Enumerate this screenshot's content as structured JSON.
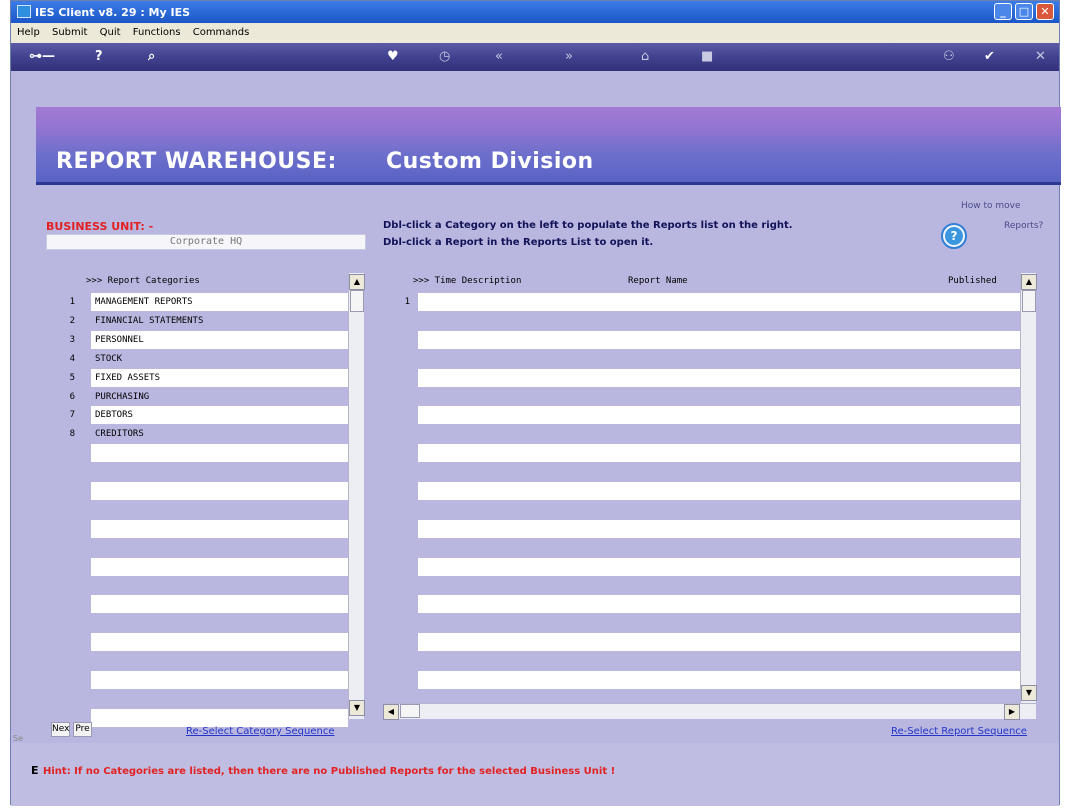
{
  "window": {
    "title": "IES Client v8. 29 : My IES"
  },
  "menu": [
    "Help",
    "Submit",
    "Quit",
    "Functions",
    "Commands"
  ],
  "toolbar": {
    "icons": [
      "key-icon",
      "help-icon",
      "search-icon",
      "heart-icon",
      "clock-icon",
      "rewind-icon",
      "forward-icon",
      "fold-icon",
      "stop-icon",
      "link-icon",
      "check-icon",
      "close-icon"
    ]
  },
  "banner": {
    "title": "REPORT WAREHOUSE:",
    "subtitle": "Custom Division"
  },
  "business_unit": {
    "label": "BUSINESS UNIT: -",
    "value": "Corporate HQ"
  },
  "instructions": [
    "Dbl-click a Category on the left to populate the Reports list on the right.",
    "Dbl-click a Report in the Reports  List  to open it."
  ],
  "how_to": {
    "line1": "How to move",
    "line2": "Reports?",
    "icon": "question-icon"
  },
  "categories": {
    "header": ">>> Report Categories",
    "rows": [
      {
        "n": "1",
        "name": "MANAGEMENT REPORTS"
      },
      {
        "n": "2",
        "name": "FINANCIAL STATEMENTS"
      },
      {
        "n": "3",
        "name": "PERSONNEL"
      },
      {
        "n": "4",
        "name": "STOCK"
      },
      {
        "n": "5",
        "name": "FIXED ASSETS"
      },
      {
        "n": "6",
        "name": "PURCHASING"
      },
      {
        "n": "7",
        "name": "DEBTORS"
      },
      {
        "n": "8",
        "name": "CREDITORS"
      }
    ]
  },
  "reports": {
    "headers": {
      "time": ">>> Time Description",
      "name": "Report Name",
      "published": "Published"
    },
    "first_row_number": "1"
  },
  "nav": {
    "next": "Nex",
    "prev": "Pre"
  },
  "links": {
    "reselect_category": "Re-Select Category Sequence",
    "reselect_report": "Re-Select Report Sequence"
  },
  "hint": {
    "marker": "E",
    "text": "Hint: If no Categories are listed, then there are no Published Reports for  the selected Business Unit !"
  },
  "side_cut": "Se"
}
